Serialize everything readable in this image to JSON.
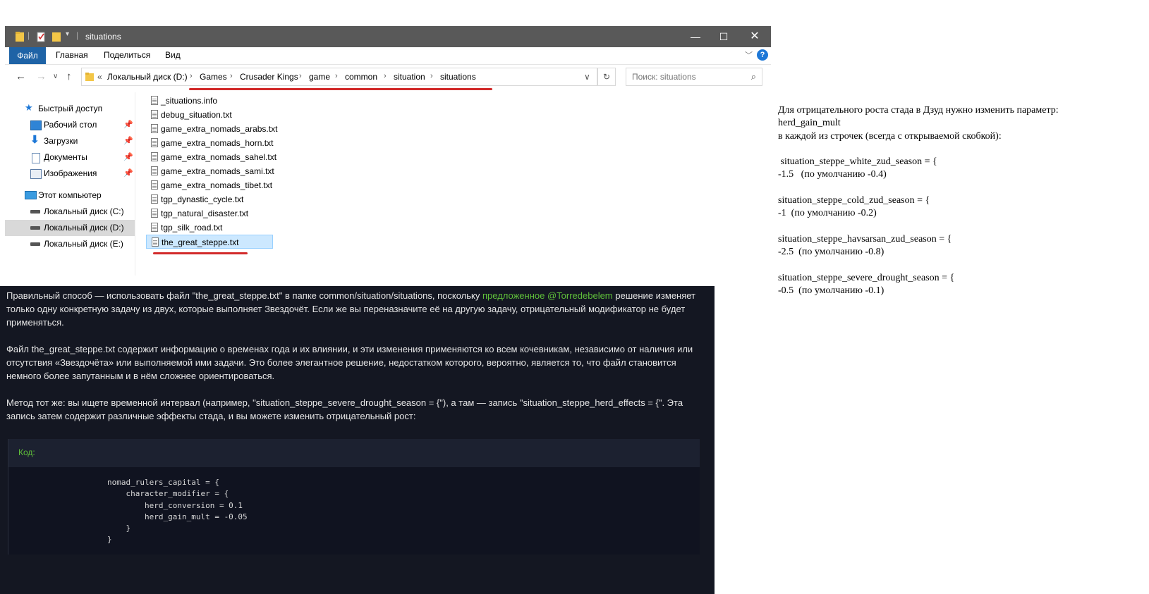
{
  "explorer": {
    "title": "situations",
    "ribbon_tabs": [
      "Файл",
      "Главная",
      "Поделиться",
      "Вид"
    ],
    "address": {
      "prefix": "«",
      "crumbs": [
        "Локальный диск (D:)",
        "Games",
        "Crusader Kings",
        "game",
        "common",
        "situation",
        "situations"
      ]
    },
    "search_placeholder": "Поиск: situations",
    "nav": [
      {
        "label": "Быстрый доступ",
        "icon": "star-icon",
        "pinned": false
      },
      {
        "label": "Рабочий стол",
        "icon": "desktop-icon",
        "pinned": true
      },
      {
        "label": "Загрузки",
        "icon": "downloads-icon",
        "pinned": true
      },
      {
        "label": "Документы",
        "icon": "documents-icon",
        "pinned": true
      },
      {
        "label": "Изображения",
        "icon": "pictures-icon",
        "pinned": true
      },
      {
        "label": "Этот компьютер",
        "icon": "computer-icon",
        "pinned": false
      },
      {
        "label": "Локальный диск (C:)",
        "icon": "drive-icon",
        "pinned": false
      },
      {
        "label": "Локальный диск (D:)",
        "icon": "drive-icon",
        "pinned": false,
        "selected": true
      },
      {
        "label": "Локальный диск (E:)",
        "icon": "drive-icon",
        "pinned": false
      }
    ],
    "files": [
      "_situations.info",
      "debug_situation.txt",
      "game_extra_nomads_arabs.txt",
      "game_extra_nomads_horn.txt",
      "game_extra_nomads_sahel.txt",
      "game_extra_nomads_sami.txt",
      "game_extra_nomads_tibet.txt",
      "tgp_dynastic_cycle.txt",
      "tgp_natural_disaster.txt",
      "tgp_silk_road.txt",
      "the_great_steppe.txt"
    ],
    "selected_file": "the_great_steppe.txt"
  },
  "post": {
    "p1_before": "Правильный способ — использовать файл \"the_great_steppe.txt\" в папке common/situation/situations, поскольку ",
    "p1_link": "предложенное @Torredebelem",
    "p1_after": " решение изменяет только одну конкретную задачу из двух, которые выполняет Звездочёт. Если же вы переназначите её на другую задачу, отрицательный модификатор не будет применяться.",
    "p2": "Файл the_great_steppe.txt содержит информацию о временах года и их влиянии, и эти изменения применяются ко всем кочевникам, независимо от наличия или отсутствия «Звездочёта» или выполняемой ими задачи. Это более элегантное решение, недостатком которого, вероятно, является то, что файл становится немного более запутанным и в нём сложнее ориентироваться.",
    "p3": "Метод тот же: вы ищете временной интервал (например, \"situation_steppe_severe_drought_season = {\"), а там — запись \"situation_steppe_herd_effects = {\". Эта запись затем содержит различные эффекты стада, и вы можете изменить отрицательный рост:",
    "code_label": "Код:",
    "code": "nomad_rulers_capital = {\n    character_modifier = {\n        herd_conversion = 0.1\n        herd_gain_mult = -0.05\n    }\n}"
  },
  "note": {
    "lines": [
      "Для отрицательного роста стада в Дзуд нужно изменить параметр:",
      "herd_gain_mult",
      "в каждой из строчек (всегда с открываемой скобкой):",
      "",
      " situation_steppe_white_zud_season = {",
      "-1.5   (по умолчанию -0.4)",
      "",
      "situation_steppe_cold_zud_season = {",
      "-1  (по умолчанию -0.2)",
      "",
      "situation_steppe_havsarsan_zud_season = {",
      "-2.5  (по умолчанию -0.8)",
      "",
      "situation_steppe_severe_drought_season = {",
      "-0.5  (по умолчанию -0.1)"
    ]
  }
}
